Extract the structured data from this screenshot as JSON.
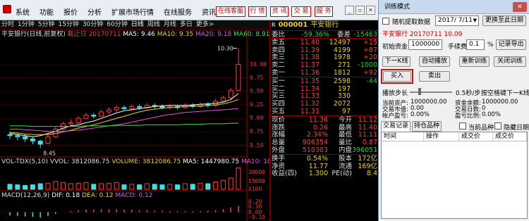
{
  "menu": {
    "items": [
      "系统",
      "功能",
      "报价",
      "分析",
      "扩展市场行情",
      "在线服务",
      "资讯",
      "工具"
    ]
  },
  "toolbar": {
    "buttons": [
      "在线客服",
      "行 情",
      "资 讯",
      "交 易",
      "服 务"
    ]
  },
  "chart_tabs": [
    "分时",
    "1分钟",
    "5分钟",
    "15分钟",
    "30分钟",
    "60分钟",
    "日线",
    "周线",
    "月线",
    "多日",
    "更多>"
  ],
  "price_chart": {
    "title": "平安银行(日线,前复权)",
    "cutoff": "截止日 20170711",
    "ma5": "MA5: 9.46",
    "ma10": "MA10: 9.35",
    "ma20": "MA20: 9.18",
    "ma60": "MA60: 8.91",
    "high_label": "10.30",
    "low_label": "8.45",
    "y_ticks": [
      "10.00",
      "9.75",
      "9.50",
      "9.25",
      "9.00",
      "8.75",
      "8.50"
    ],
    "chart_data": {
      "type": "line",
      "series": [
        {
          "name": "MA5",
          "values": [
            8.72,
            8.7,
            8.68,
            8.66,
            8.68,
            8.72,
            8.76,
            8.82,
            8.86,
            8.88,
            8.92,
            8.95,
            9.0,
            9.05,
            9.1,
            9.14,
            9.16,
            9.18,
            9.2,
            9.22,
            9.23,
            9.24,
            9.24,
            9.24,
            9.25,
            9.26,
            9.27,
            9.28,
            9.3,
            9.35,
            9.46
          ]
        },
        {
          "name": "MA10",
          "values": [
            8.74,
            8.73,
            8.71,
            8.7,
            8.7,
            8.7,
            8.72,
            8.75,
            8.78,
            8.82,
            8.85,
            8.88,
            8.92,
            8.96,
            9.0,
            9.04,
            9.08,
            9.12,
            9.15,
            9.17,
            9.19,
            9.2,
            9.21,
            9.22,
            9.22,
            9.23,
            9.24,
            9.25,
            9.27,
            9.3,
            9.35
          ]
        },
        {
          "name": "MA20",
          "values": [
            8.8,
            8.8,
            8.79,
            8.78,
            8.77,
            8.76,
            8.76,
            8.76,
            8.77,
            8.78,
            8.8,
            8.82,
            8.84,
            8.86,
            8.88,
            8.9,
            8.93,
            8.96,
            8.99,
            9.02,
            9.05,
            9.07,
            9.09,
            9.11,
            9.12,
            9.13,
            9.14,
            9.15,
            9.16,
            9.17,
            9.18
          ]
        },
        {
          "name": "MA60",
          "values": [
            8.86,
            8.86,
            8.86,
            8.85,
            8.85,
            8.85,
            8.85,
            8.85,
            8.85,
            8.85,
            8.86,
            8.86,
            8.86,
            8.86,
            8.87,
            8.87,
            8.87,
            8.87,
            8.88,
            8.88,
            8.88,
            8.88,
            8.88,
            8.89,
            8.89,
            8.89,
            8.9,
            8.9,
            8.9,
            8.91,
            8.91
          ]
        }
      ],
      "candles": [
        {
          "o": 8.7,
          "c": 8.68,
          "h": 8.76,
          "l": 8.62
        },
        {
          "o": 8.68,
          "c": 8.66,
          "h": 8.72,
          "l": 8.6
        },
        {
          "o": 8.66,
          "c": 8.62,
          "h": 8.7,
          "l": 8.56
        },
        {
          "o": 8.62,
          "c": 8.58,
          "h": 8.66,
          "l": 8.52
        },
        {
          "o": 8.58,
          "c": 8.52,
          "h": 8.6,
          "l": 8.45
        },
        {
          "o": 8.54,
          "c": 8.66,
          "h": 8.7,
          "l": 8.52
        },
        {
          "o": 8.66,
          "c": 8.8,
          "h": 8.84,
          "l": 8.64
        },
        {
          "o": 8.8,
          "c": 8.9,
          "h": 8.94,
          "l": 8.78
        },
        {
          "o": 8.9,
          "c": 8.92,
          "h": 8.98,
          "l": 8.86
        },
        {
          "o": 8.92,
          "c": 9.0,
          "h": 9.04,
          "l": 8.9
        },
        {
          "o": 9.0,
          "c": 9.06,
          "h": 9.1,
          "l": 8.98
        },
        {
          "o": 9.06,
          "c": 9.04,
          "h": 9.1,
          "l": 9.0
        },
        {
          "o": 9.04,
          "c": 9.12,
          "h": 9.16,
          "l": 9.02
        },
        {
          "o": 9.12,
          "c": 9.16,
          "h": 9.2,
          "l": 9.08
        },
        {
          "o": 9.16,
          "c": 9.2,
          "h": 9.24,
          "l": 9.12
        },
        {
          "o": 9.2,
          "c": 9.18,
          "h": 9.24,
          "l": 9.14
        },
        {
          "o": 9.18,
          "c": 9.22,
          "h": 9.26,
          "l": 9.14
        },
        {
          "o": 9.22,
          "c": 9.2,
          "h": 9.26,
          "l": 9.16
        },
        {
          "o": 9.2,
          "c": 9.24,
          "h": 9.28,
          "l": 9.18
        },
        {
          "o": 9.24,
          "c": 9.22,
          "h": 9.28,
          "l": 9.18
        },
        {
          "o": 9.22,
          "c": 9.2,
          "h": 9.26,
          "l": 9.16
        },
        {
          "o": 9.2,
          "c": 9.22,
          "h": 9.26,
          "l": 9.17
        },
        {
          "o": 9.22,
          "c": 9.2,
          "h": 9.25,
          "l": 9.16
        },
        {
          "o": 9.2,
          "c": 9.24,
          "h": 9.28,
          "l": 9.18
        },
        {
          "o": 9.24,
          "c": 9.22,
          "h": 9.28,
          "l": 9.19
        },
        {
          "o": 9.22,
          "c": 9.26,
          "h": 9.3,
          "l": 9.2
        },
        {
          "o": 9.26,
          "c": 9.24,
          "h": 9.3,
          "l": 9.2
        },
        {
          "o": 9.24,
          "c": 9.32,
          "h": 9.36,
          "l": 9.22
        },
        {
          "o": 9.32,
          "c": 9.38,
          "h": 9.42,
          "l": 9.3
        },
        {
          "o": 9.38,
          "c": 9.52,
          "h": 9.56,
          "l": 9.36
        },
        {
          "o": 9.52,
          "c": 10.0,
          "h": 10.3,
          "l": 9.5
        }
      ],
      "ylim": [
        8.35,
        10.45
      ]
    }
  },
  "vol_chart": {
    "title": "VOL-TDX(5,10)",
    "vvol": "VVOL: 3812086.75",
    "volume": "VOLUME: 3812086.75",
    "ma5": "MA5: 1447980.75",
    "ma10": "MA10: 102738",
    "y_ticks": [
      "30000",
      "15000",
      "X100"
    ],
    "chart_data": {
      "type": "bar",
      "values": [
        9,
        8,
        7,
        8,
        10,
        11,
        14,
        12,
        10,
        11,
        12,
        9,
        10,
        11,
        12,
        8,
        9,
        8,
        10,
        9,
        8,
        9,
        8,
        10,
        9,
        11,
        10,
        13,
        16,
        20,
        38
      ],
      "ylim": [
        0,
        40
      ]
    }
  },
  "macd_chart": {
    "title": "MACD(12,26,9)",
    "dif": "DIF: 0.18",
    "dea": "DEA: 0.12",
    "macd": "MACD: 0.12",
    "y_ticks": [
      "0.20",
      "0.10",
      "0.00",
      "-0.10"
    ],
    "chart_data": {
      "type": "bar",
      "values": [
        -0.06,
        -0.07,
        -0.08,
        -0.09,
        -0.1,
        -0.07,
        -0.03,
        0.0,
        0.02,
        0.04,
        0.05,
        0.05,
        0.06,
        0.06,
        0.06,
        0.05,
        0.05,
        0.04,
        0.04,
        0.03,
        0.03,
        0.02,
        0.02,
        0.02,
        0.02,
        0.02,
        0.03,
        0.04,
        0.06,
        0.09,
        0.12
      ],
      "ylim": [
        -0.14,
        0.22
      ]
    }
  },
  "quote": {
    "r_badge": "R",
    "code": "000001",
    "name": "平安银行",
    "weibi_label": "委比",
    "weibi": "-59.36%",
    "weicha_label": "委差",
    "weicha": "-15463",
    "asks": [
      {
        "label": "卖五",
        "price": "11.40",
        "vol": "12497",
        "chg": "+15"
      },
      {
        "label": "卖四",
        "price": "11.39",
        "vol": "4199",
        "chg": "+87"
      },
      {
        "label": "卖三",
        "price": "11.38",
        "vol": "1978",
        "chg": "+20"
      },
      {
        "label": "卖二",
        "price": "11.37",
        "vol": "271",
        "chg": "-1000"
      },
      {
        "label": "卖一",
        "price": "11.36",
        "vol": "1812",
        "chg": "+92"
      }
    ],
    "bids": [
      {
        "label": "买一",
        "price": "11.35",
        "vol": "2598",
        "chg": "-44"
      },
      {
        "label": "买二",
        "price": "11.34",
        "vol": "197",
        "chg": ""
      },
      {
        "label": "买三",
        "price": "11.33",
        "vol": "330",
        "chg": ""
      },
      {
        "label": "买四",
        "price": "11.32",
        "vol": "2072",
        "chg": ""
      },
      {
        "label": "买五",
        "price": "11.31",
        "vol": "97",
        "chg": ""
      }
    ],
    "stats": [
      {
        "l1": "现价",
        "v1": "11.36",
        "l2": "今开",
        "v2": "11.12"
      },
      {
        "l1": "涨跌",
        "v1": "0.26",
        "l2": "最高",
        "v2": "11.40"
      },
      {
        "l1": "涨幅",
        "v1": "2.34%",
        "l2": "最低",
        "v2": "11.11"
      },
      {
        "l1": "总量",
        "v1": "906354",
        "l2": "量比",
        "v2": "0.87"
      },
      {
        "l1": "外盘",
        "v1": "510303",
        "l2": "内盘",
        "v2": "396051"
      }
    ],
    "stats2": [
      {
        "l1": "换手",
        "v1": "0.54%",
        "l2": "股本",
        "v2": "172亿"
      },
      {
        "l1": "净资",
        "v1": "11.77",
        "l2": "流通",
        "v2": "169亿"
      },
      {
        "l1": "收益(四)",
        "v1": "1.300",
        "l2": "PE(动)",
        "v2": "8.4"
      }
    ]
  },
  "dialog": {
    "title": "训练模式",
    "close": "✕",
    "random_label": "随机提取数据",
    "date_value": "2017/ 7/11",
    "change_date": "更换至此日期",
    "stock_line": "平安银行 20170711 10.09",
    "init_fund_label": "初始资金",
    "init_fund": "1000000",
    "fee_label": "手续费",
    "fee": "0.1",
    "percent": "%",
    "export": "记录导出",
    "next_k": "下一K线",
    "autoplay": "自动播放",
    "retrain": "重新训练",
    "close_train": "关闭训练",
    "buy": "买入",
    "sell": "卖出",
    "step_label": "播放步长",
    "step_value": "0.5秒/步",
    "space_hint": "按空格键下一K线",
    "account": [
      [
        "当前资产:",
        "1000000.00",
        "资金余额:",
        "1000000.00"
      ],
      [
        "交易市值:",
        "0.00",
        "交易日数:",
        "0"
      ],
      [
        "帐户盈亏:",
        "0.00%",
        "盈亏比例:",
        "0.00%"
      ]
    ],
    "tab_trades": "交易记录",
    "tab_hold": "持仓品种",
    "cur_only": "当前品种",
    "hide_trade": "隐藏日期",
    "cols": [
      "时间",
      "操作",
      "成交价",
      "成交价"
    ]
  }
}
